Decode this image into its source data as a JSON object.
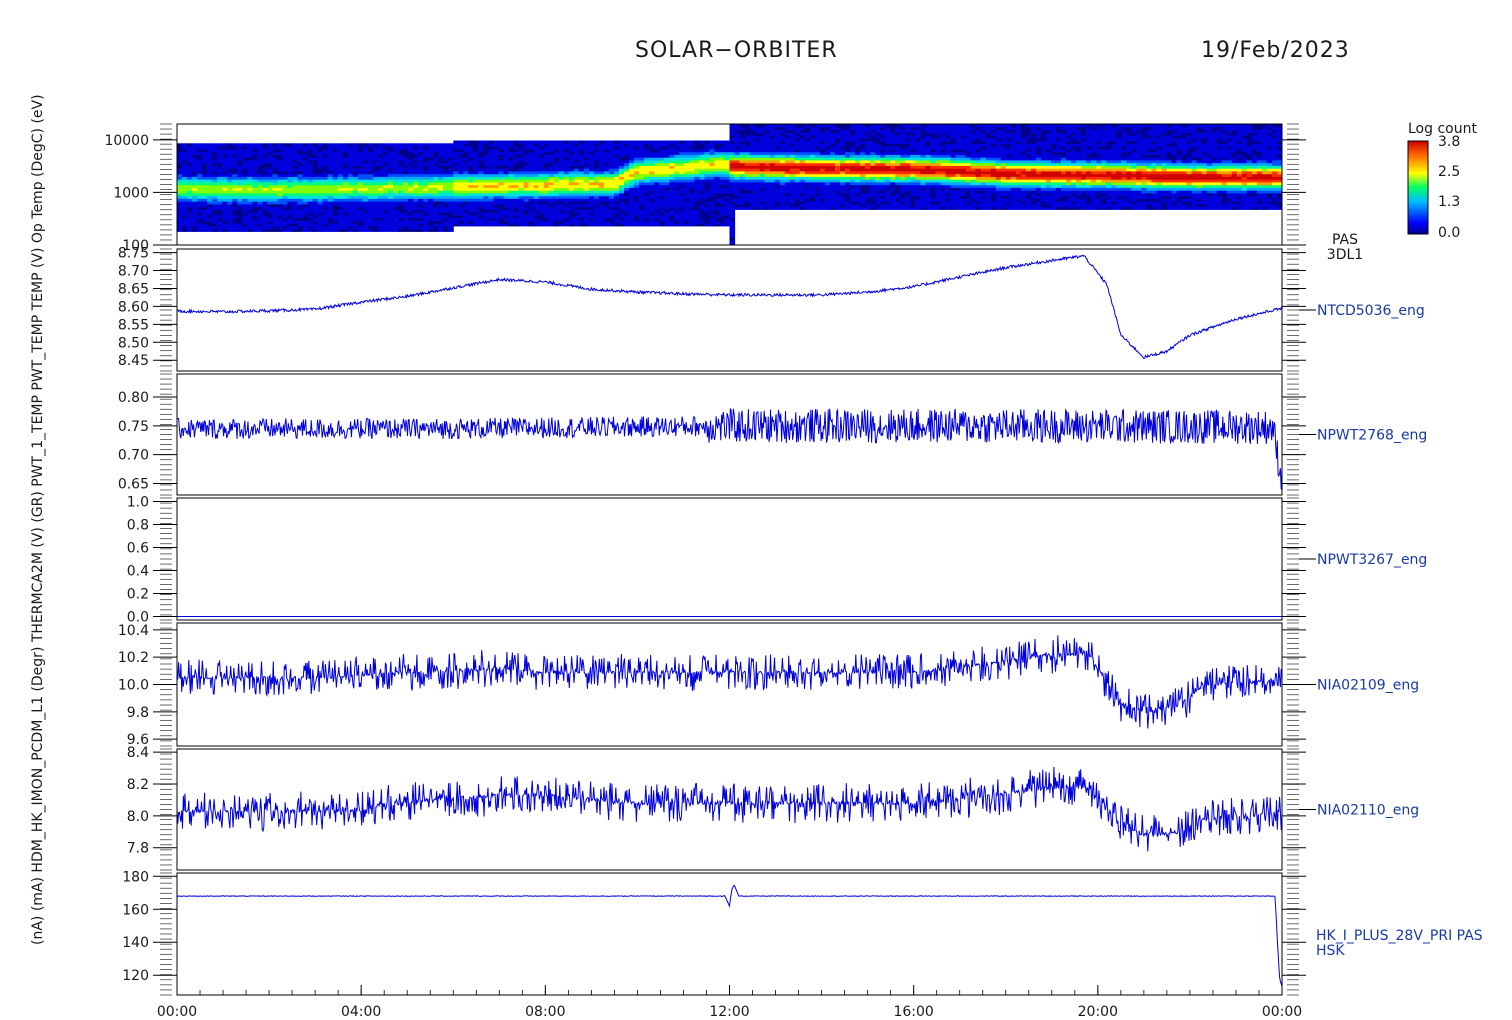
{
  "header": {
    "title": "SOLAR−ORBITER",
    "date": "19/Feb/2023"
  },
  "colors": {
    "trace": "#0000dd",
    "axis": "#000000",
    "label": "#1a3aa0"
  },
  "chart_data": {
    "type": "line",
    "shared_x": {
      "ticks": [
        "00:00",
        "04:00",
        "08:00",
        "12:00",
        "16:00",
        "20:00",
        "00:00"
      ],
      "range_hours": [
        0,
        24
      ]
    },
    "left_axis_label_overlap": "(nA)  (mA)  HDM_HK_IMON_PCDM_L1  (Degr)  THERMCA2M   (V)   (GR)  PWT_1_TEMP   PWT_TEMP   TEMP   (V)   Op   Temp (DegC)   (eV)",
    "panels": [
      {
        "type": "heatmap",
        "ylabel": "(eV)",
        "y_scale": "log",
        "ylim": [
          100,
          20000
        ],
        "y_ticks": [
          "10000",
          "1000",
          "100"
        ],
        "right_label": [
          "PAS",
          "3DL1"
        ],
        "colorbar": {
          "title": "Log count",
          "ticks": [
            "3.8",
            "2.5",
            "1.3",
            "0.0"
          ],
          "range": [
            0.0,
            3.8
          ]
        },
        "band_center_eV": [
          [
            0,
            1200
          ],
          [
            2,
            1150
          ],
          [
            4,
            1200
          ],
          [
            6,
            1300
          ],
          [
            8,
            1400
          ],
          [
            9.5,
            1500
          ],
          [
            10,
            2500
          ],
          [
            11,
            3000
          ],
          [
            11.8,
            3500
          ],
          [
            12.1,
            3200
          ],
          [
            14,
            2900
          ],
          [
            16,
            2800
          ],
          [
            17,
            2600
          ],
          [
            18,
            2300
          ],
          [
            20,
            2200
          ],
          [
            22,
            2000
          ],
          [
            24,
            2000
          ]
        ]
      },
      {
        "type": "line",
        "ylabel": "Temp (DegC)",
        "ylim": [
          8.42,
          8.76
        ],
        "y_ticks": [
          "8.75",
          "8.70",
          "8.65",
          "8.60",
          "8.55",
          "8.50",
          "8.45"
        ],
        "right_label": "NTCD5036_eng",
        "x": [
          0,
          1,
          2,
          3,
          4,
          5,
          6,
          7,
          8,
          9,
          10,
          11,
          12,
          13,
          14,
          15,
          16,
          17,
          18,
          19,
          19.7,
          20.2,
          20.5,
          21,
          21.5,
          22,
          23,
          24
        ],
        "values": [
          8.587,
          8.585,
          8.588,
          8.592,
          8.612,
          8.628,
          8.652,
          8.675,
          8.668,
          8.648,
          8.64,
          8.635,
          8.632,
          8.632,
          8.632,
          8.64,
          8.655,
          8.682,
          8.708,
          8.728,
          8.741,
          8.66,
          8.52,
          8.458,
          8.475,
          8.52,
          8.565,
          8.595
        ],
        "noise": 0.004
      },
      {
        "type": "line",
        "ylabel": "PWT_TEMP",
        "ylim": [
          0.63,
          0.84
        ],
        "y_ticks": [
          "0.80",
          "0.75",
          "0.70",
          "0.65"
        ],
        "right_label": "NPWT2768_eng",
        "x": [
          0,
          6,
          12,
          18,
          23.8,
          23.9,
          24
        ],
        "values": [
          0.745,
          0.745,
          0.75,
          0.75,
          0.748,
          0.7,
          0.655
        ],
        "noise": [
          0.018,
          0.03
        ]
      },
      {
        "type": "line",
        "ylabel": "PWT_1_TEMP",
        "ylim": [
          -0.03,
          1.03
        ],
        "y_ticks": [
          "1.0",
          "0.8",
          "0.6",
          "0.4",
          "0.2",
          "0.0"
        ],
        "right_label": "NPWT3267_eng",
        "x": [
          0,
          24
        ],
        "values": [
          0.0,
          0.0
        ],
        "noise": 0.0
      },
      {
        "type": "line",
        "ylabel": "THERMCA2M (Degr)",
        "ylim": [
          9.55,
          10.45
        ],
        "y_ticks": [
          "10.4",
          "10.2",
          "10.0",
          "9.8",
          "9.6"
        ],
        "right_label": "NIA02109_eng",
        "x": [
          0,
          3,
          4.5,
          5,
          7,
          8,
          10,
          12,
          14,
          16,
          17.5,
          19,
          19.8,
          20.5,
          21,
          21.8,
          22.3,
          24
        ],
        "values": [
          10.05,
          10.05,
          10.08,
          10.09,
          10.12,
          10.09,
          10.09,
          10.09,
          10.09,
          10.09,
          10.15,
          10.22,
          10.22,
          9.86,
          9.8,
          9.85,
          10.0,
          10.03
        ],
        "noise": 0.13
      },
      {
        "type": "line",
        "ylabel": "(V)",
        "ylim": [
          7.66,
          8.42
        ],
        "y_ticks": [
          "8.4",
          "8.2",
          "8.0",
          "7.8"
        ],
        "right_label": "NIA02110_eng",
        "x": [
          0,
          4,
          4.5,
          7,
          8,
          10,
          12,
          14,
          16,
          17.5,
          19,
          19.8,
          20.5,
          21,
          21.8,
          22.3,
          24
        ],
        "values": [
          8.03,
          8.03,
          8.08,
          8.13,
          8.13,
          8.08,
          8.08,
          8.08,
          8.08,
          8.12,
          8.18,
          8.18,
          7.96,
          7.88,
          7.9,
          7.98,
          8.02
        ],
        "noise": 0.12
      },
      {
        "type": "line",
        "ylabel": "HDM_HK_IMON_PCDM_L1 (mA)",
        "ylim": [
          108,
          182
        ],
        "y_ticks": [
          "180",
          "160",
          "140",
          "120"
        ],
        "right_label": [
          "HK_I_PLUS_28V_PRI PAS",
          "HSK"
        ],
        "x": [
          0,
          11.9,
          12.0,
          12.05,
          12.1,
          12.2,
          23.85,
          23.9,
          23.95,
          24
        ],
        "values": [
          168,
          168,
          162,
          172,
          175,
          168,
          168,
          140,
          118,
          113
        ],
        "noise": 0.2
      }
    ]
  }
}
